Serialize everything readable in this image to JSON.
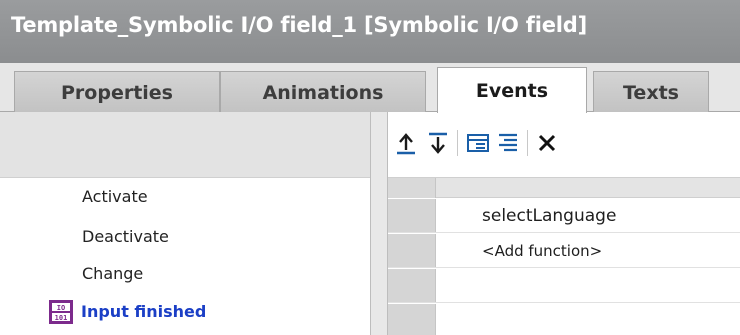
{
  "window": {
    "title": "Template_Symbolic I/O field_1 [Symbolic I/O field]"
  },
  "tabs": [
    {
      "label": "Properties",
      "active": false
    },
    {
      "label": "Animations",
      "active": false
    },
    {
      "label": "Events",
      "active": true
    },
    {
      "label": "Texts",
      "active": false
    }
  ],
  "events": {
    "items": [
      {
        "label": "Activate",
        "selected": false
      },
      {
        "label": "Deactivate",
        "selected": false
      },
      {
        "label": "Change",
        "selected": false
      },
      {
        "label": "Input finished",
        "selected": true,
        "icon": "io-field-icon"
      }
    ]
  },
  "toolbar": {
    "buttons": [
      {
        "name": "move-up-icon",
        "tooltip": ""
      },
      {
        "name": "move-down-icon",
        "tooltip": ""
      },
      {
        "name": "expand-all-icon",
        "tooltip": ""
      },
      {
        "name": "collapse-all-icon",
        "tooltip": ""
      },
      {
        "name": "delete-icon",
        "tooltip": ""
      }
    ]
  },
  "function_list": {
    "rows": [
      {
        "text": "selectLanguage"
      },
      {
        "text": "<Add function>"
      },
      {
        "text": ""
      }
    ]
  },
  "colors": {
    "titlebar": "#8f9193",
    "selected_event": "#1b3fc6",
    "toolbar_icon": "#1a5fa8"
  }
}
